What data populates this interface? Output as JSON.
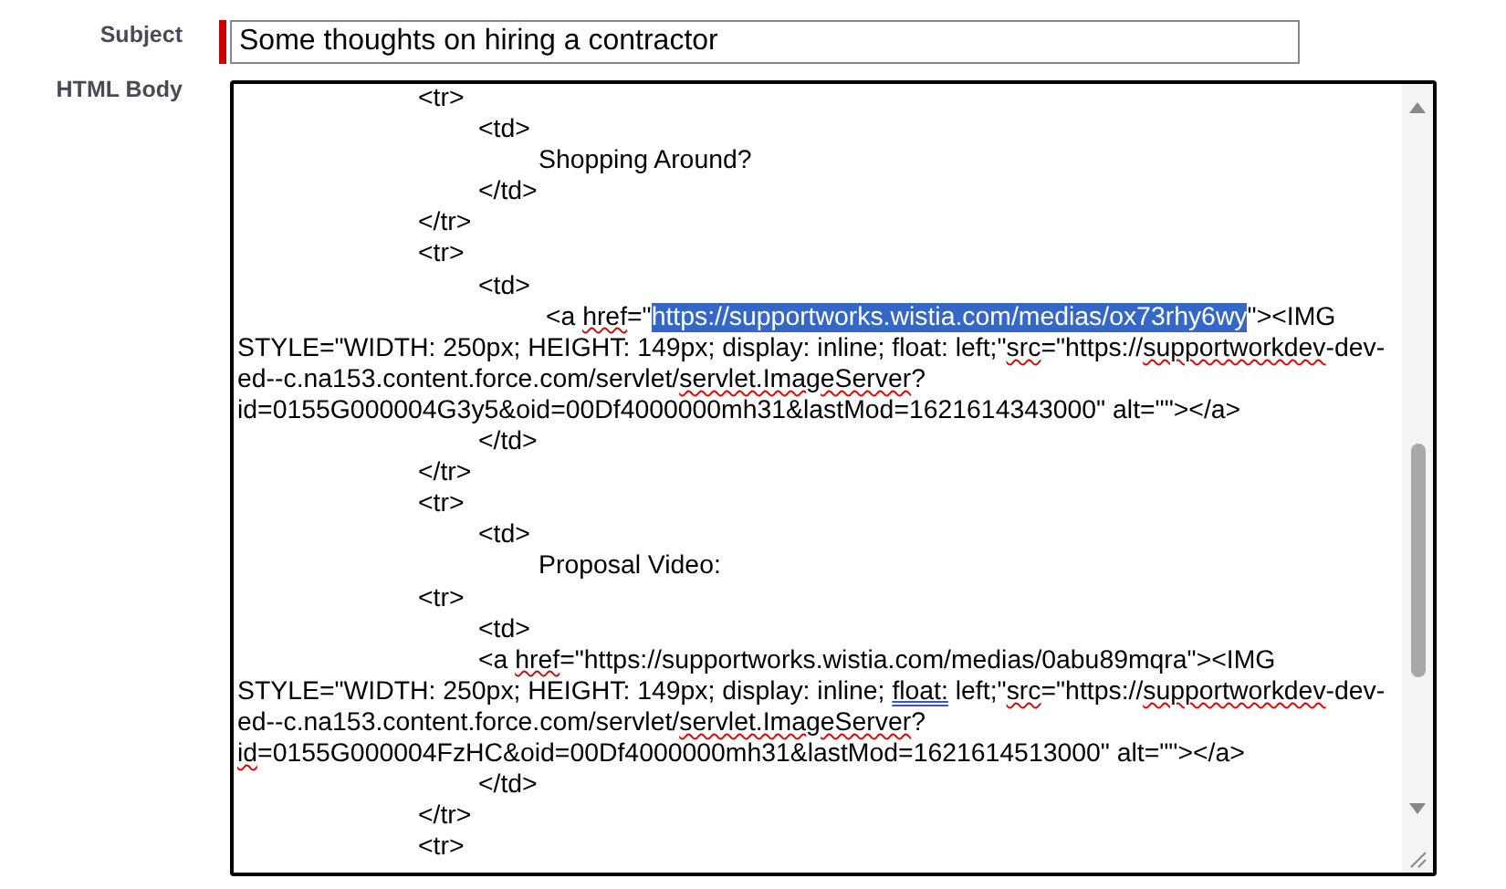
{
  "subject": {
    "label": "Subject",
    "value": "Some thoughts on hiring a contractor",
    "required": true
  },
  "html_body": {
    "label": "HTML Body",
    "lines": [
      {
        "segments": [
          {
            "text": "\t\t\t<tr>",
            "kind": "plain",
            "selected": false
          }
        ]
      },
      {
        "segments": [
          {
            "text": "\t\t\t\t<td>",
            "kind": "plain",
            "selected": false
          }
        ]
      },
      {
        "segments": [
          {
            "text": "\t\t\t\t\tShopping Around?",
            "kind": "plain",
            "selected": false
          }
        ]
      },
      {
        "segments": [
          {
            "text": "\t\t\t\t</td>",
            "kind": "plain",
            "selected": false
          }
        ]
      },
      {
        "segments": [
          {
            "text": "\t\t\t</tr>",
            "kind": "plain",
            "selected": false
          }
        ]
      },
      {
        "segments": [
          {
            "text": "\t\t\t<tr>",
            "kind": "plain",
            "selected": false
          }
        ]
      },
      {
        "segments": [
          {
            "text": "\t\t\t\t<td>",
            "kind": "plain",
            "selected": false
          }
        ]
      },
      {
        "segments": [
          {
            "text": "\t\t\t\t\t <a ",
            "kind": "plain",
            "selected": false
          },
          {
            "text": "href",
            "kind": "misspelled",
            "selected": false
          },
          {
            "text": "=\"",
            "kind": "plain",
            "selected": false
          },
          {
            "text": "https://supportworks.wistia.com/medias/ox73rhy6wy",
            "kind": "plain",
            "selected": true
          },
          {
            "text": "\"><IMG STYLE=\"WIDTH: 250px; HEIGHT: 149px; display: inline; float: left;\"",
            "kind": "plain",
            "selected": false
          },
          {
            "text": "src",
            "kind": "misspelled",
            "selected": false
          },
          {
            "text": "=\"https://",
            "kind": "plain",
            "selected": false
          },
          {
            "text": "supportworkdev",
            "kind": "misspelled",
            "selected": false
          },
          {
            "text": "-dev-ed--c.na153.content.force.com/servlet/",
            "kind": "plain",
            "selected": false
          },
          {
            "text": "servlet.ImageServer",
            "kind": "misspelled",
            "selected": false
          },
          {
            "text": "?id=0155G000004G3y5&oid=00Df4000000mh31&lastMod=1621614343000\" alt=\"\"></a>",
            "kind": "plain",
            "selected": false
          }
        ]
      },
      {
        "segments": [
          {
            "text": "\t\t\t\t</td>",
            "kind": "plain",
            "selected": false
          }
        ]
      },
      {
        "segments": [
          {
            "text": "\t\t\t</tr>",
            "kind": "plain",
            "selected": false
          }
        ]
      },
      {
        "segments": [
          {
            "text": "\t\t\t<tr>",
            "kind": "plain",
            "selected": false
          }
        ]
      },
      {
        "segments": [
          {
            "text": "\t\t\t\t<td>",
            "kind": "plain",
            "selected": false
          }
        ]
      },
      {
        "segments": [
          {
            "text": "\t\t\t\t\tProposal Video:",
            "kind": "plain",
            "selected": false
          }
        ]
      },
      {
        "segments": [
          {
            "text": "\t\t\t<tr>",
            "kind": "plain",
            "selected": false
          }
        ]
      },
      {
        "segments": [
          {
            "text": "\t\t\t\t<td>",
            "kind": "plain",
            "selected": false
          }
        ]
      },
      {
        "segments": [
          {
            "text": "\t\t\t\t<a ",
            "kind": "plain",
            "selected": false
          },
          {
            "text": "href",
            "kind": "misspelled",
            "selected": false
          },
          {
            "text": "=\"https://supportworks.wistia.com/medias/0abu89mqra\"><IMG STYLE=\"WIDTH: 250px; HEIGHT: 149px; display: inline; ",
            "kind": "plain",
            "selected": false
          },
          {
            "text": "float:",
            "kind": "grammar",
            "selected": false
          },
          {
            "text": " left;\"",
            "kind": "plain",
            "selected": false
          },
          {
            "text": "src",
            "kind": "misspelled",
            "selected": false
          },
          {
            "text": "=\"https://",
            "kind": "plain",
            "selected": false
          },
          {
            "text": "supportworkdev",
            "kind": "misspelled",
            "selected": false
          },
          {
            "text": "-dev-ed--c.na153.content.force.com/servlet/",
            "kind": "plain",
            "selected": false
          },
          {
            "text": "servlet.ImageServer",
            "kind": "misspelled",
            "selected": false
          },
          {
            "text": "?",
            "kind": "plain",
            "selected": false
          },
          {
            "text": "id",
            "kind": "misspelled",
            "selected": false
          },
          {
            "text": "=0155G000004FzHC&oid=00Df4000000mh31&lastMod=1621614513000\" alt=\"\"></a>",
            "kind": "plain",
            "selected": false
          }
        ]
      },
      {
        "segments": [
          {
            "text": "\t\t\t\t</td>",
            "kind": "plain",
            "selected": false
          }
        ]
      },
      {
        "segments": [
          {
            "text": "\t\t\t</tr>",
            "kind": "plain",
            "selected": false
          }
        ]
      },
      {
        "segments": [
          {
            "text": "\t\t\t<tr>",
            "kind": "plain",
            "selected": false
          }
        ]
      }
    ]
  }
}
